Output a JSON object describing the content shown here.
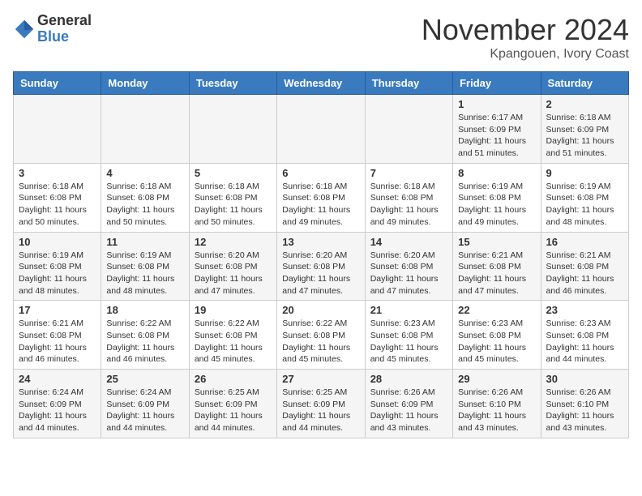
{
  "logo": {
    "general": "General",
    "blue": "Blue"
  },
  "title": "November 2024",
  "location": "Kpangouen, Ivory Coast",
  "weekdays": [
    "Sunday",
    "Monday",
    "Tuesday",
    "Wednesday",
    "Thursday",
    "Friday",
    "Saturday"
  ],
  "weeks": [
    [
      {
        "day": "",
        "info": ""
      },
      {
        "day": "",
        "info": ""
      },
      {
        "day": "",
        "info": ""
      },
      {
        "day": "",
        "info": ""
      },
      {
        "day": "",
        "info": ""
      },
      {
        "day": "1",
        "info": "Sunrise: 6:17 AM\nSunset: 6:09 PM\nDaylight: 11 hours and 51 minutes."
      },
      {
        "day": "2",
        "info": "Sunrise: 6:18 AM\nSunset: 6:09 PM\nDaylight: 11 hours and 51 minutes."
      }
    ],
    [
      {
        "day": "3",
        "info": "Sunrise: 6:18 AM\nSunset: 6:08 PM\nDaylight: 11 hours and 50 minutes."
      },
      {
        "day": "4",
        "info": "Sunrise: 6:18 AM\nSunset: 6:08 PM\nDaylight: 11 hours and 50 minutes."
      },
      {
        "day": "5",
        "info": "Sunrise: 6:18 AM\nSunset: 6:08 PM\nDaylight: 11 hours and 50 minutes."
      },
      {
        "day": "6",
        "info": "Sunrise: 6:18 AM\nSunset: 6:08 PM\nDaylight: 11 hours and 49 minutes."
      },
      {
        "day": "7",
        "info": "Sunrise: 6:18 AM\nSunset: 6:08 PM\nDaylight: 11 hours and 49 minutes."
      },
      {
        "day": "8",
        "info": "Sunrise: 6:19 AM\nSunset: 6:08 PM\nDaylight: 11 hours and 49 minutes."
      },
      {
        "day": "9",
        "info": "Sunrise: 6:19 AM\nSunset: 6:08 PM\nDaylight: 11 hours and 48 minutes."
      }
    ],
    [
      {
        "day": "10",
        "info": "Sunrise: 6:19 AM\nSunset: 6:08 PM\nDaylight: 11 hours and 48 minutes."
      },
      {
        "day": "11",
        "info": "Sunrise: 6:19 AM\nSunset: 6:08 PM\nDaylight: 11 hours and 48 minutes."
      },
      {
        "day": "12",
        "info": "Sunrise: 6:20 AM\nSunset: 6:08 PM\nDaylight: 11 hours and 47 minutes."
      },
      {
        "day": "13",
        "info": "Sunrise: 6:20 AM\nSunset: 6:08 PM\nDaylight: 11 hours and 47 minutes."
      },
      {
        "day": "14",
        "info": "Sunrise: 6:20 AM\nSunset: 6:08 PM\nDaylight: 11 hours and 47 minutes."
      },
      {
        "day": "15",
        "info": "Sunrise: 6:21 AM\nSunset: 6:08 PM\nDaylight: 11 hours and 47 minutes."
      },
      {
        "day": "16",
        "info": "Sunrise: 6:21 AM\nSunset: 6:08 PM\nDaylight: 11 hours and 46 minutes."
      }
    ],
    [
      {
        "day": "17",
        "info": "Sunrise: 6:21 AM\nSunset: 6:08 PM\nDaylight: 11 hours and 46 minutes."
      },
      {
        "day": "18",
        "info": "Sunrise: 6:22 AM\nSunset: 6:08 PM\nDaylight: 11 hours and 46 minutes."
      },
      {
        "day": "19",
        "info": "Sunrise: 6:22 AM\nSunset: 6:08 PM\nDaylight: 11 hours and 45 minutes."
      },
      {
        "day": "20",
        "info": "Sunrise: 6:22 AM\nSunset: 6:08 PM\nDaylight: 11 hours and 45 minutes."
      },
      {
        "day": "21",
        "info": "Sunrise: 6:23 AM\nSunset: 6:08 PM\nDaylight: 11 hours and 45 minutes."
      },
      {
        "day": "22",
        "info": "Sunrise: 6:23 AM\nSunset: 6:08 PM\nDaylight: 11 hours and 45 minutes."
      },
      {
        "day": "23",
        "info": "Sunrise: 6:23 AM\nSunset: 6:08 PM\nDaylight: 11 hours and 44 minutes."
      }
    ],
    [
      {
        "day": "24",
        "info": "Sunrise: 6:24 AM\nSunset: 6:09 PM\nDaylight: 11 hours and 44 minutes."
      },
      {
        "day": "25",
        "info": "Sunrise: 6:24 AM\nSunset: 6:09 PM\nDaylight: 11 hours and 44 minutes."
      },
      {
        "day": "26",
        "info": "Sunrise: 6:25 AM\nSunset: 6:09 PM\nDaylight: 11 hours and 44 minutes."
      },
      {
        "day": "27",
        "info": "Sunrise: 6:25 AM\nSunset: 6:09 PM\nDaylight: 11 hours and 44 minutes."
      },
      {
        "day": "28",
        "info": "Sunrise: 6:26 AM\nSunset: 6:09 PM\nDaylight: 11 hours and 43 minutes."
      },
      {
        "day": "29",
        "info": "Sunrise: 6:26 AM\nSunset: 6:10 PM\nDaylight: 11 hours and 43 minutes."
      },
      {
        "day": "30",
        "info": "Sunrise: 6:26 AM\nSunset: 6:10 PM\nDaylight: 11 hours and 43 minutes."
      }
    ]
  ]
}
